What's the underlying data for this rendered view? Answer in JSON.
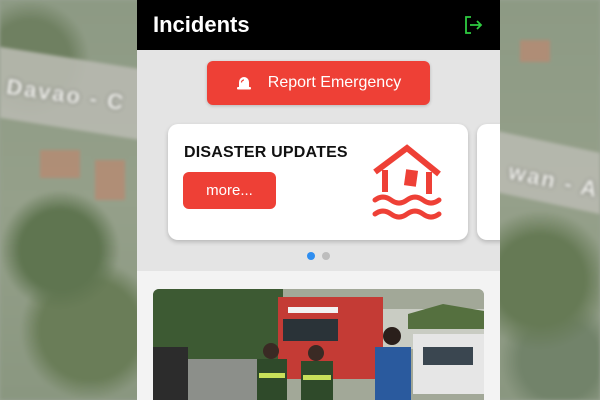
{
  "map": {
    "label_left": "Davao - C",
    "label_right": "wan - A"
  },
  "header": {
    "title": "Incidents",
    "logout_icon": "logout-icon"
  },
  "report": {
    "label": "Report Emergency",
    "icon": "alarm-bell-icon"
  },
  "carousel": {
    "cards": [
      {
        "title": "DISASTER UPDATES",
        "button_label": "more...",
        "icon": "flooded-house-icon"
      }
    ],
    "page_count": 2,
    "active_page": 1
  },
  "colors": {
    "accent": "#ee4036",
    "topbar": "#000000",
    "logout_icon": "#2ecc40",
    "active_dot": "#2f8ef0"
  },
  "feed": {
    "image": "incident-photo"
  }
}
